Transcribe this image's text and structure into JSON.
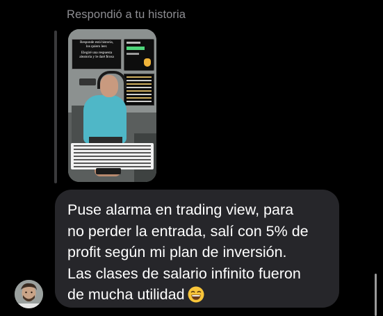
{
  "reply": {
    "label": "Respondió a tu historia"
  },
  "story_preview": {
    "card_title_line1": "Responde está historia,",
    "card_title_line2": "los quiero leer.",
    "card_title_line3": "Elegiré una respuesta",
    "card_title_line4": "aleatoria y le daré $rosa"
  },
  "message": {
    "lines": [
      "Puse alarma en trading view, para",
      "no perder la entrada, salí con 5% de",
      "profit según mi plan de inversión.",
      "Las clases de salario infinito fueron",
      "de mucha utilidad"
    ],
    "emoji": "grinning-face-with-smiling-eyes"
  },
  "colors": {
    "background": "#000000",
    "bubble": "#26262a",
    "muted_text": "#8e8e93",
    "text": "#ffffff"
  }
}
